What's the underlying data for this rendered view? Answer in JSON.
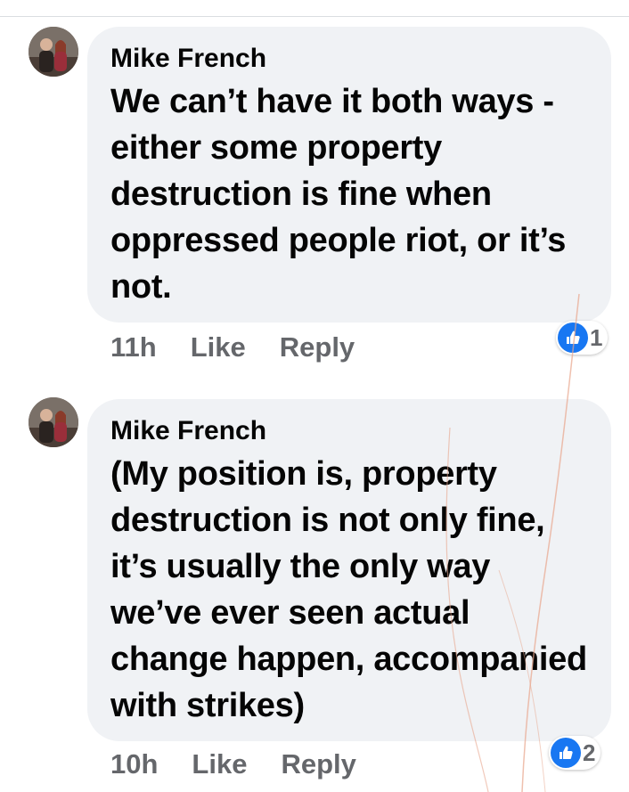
{
  "comments": [
    {
      "author": "Mike French",
      "text": "We can’t have it both ways - either some property destruction is fine when oppressed people riot, or it’s not.",
      "time": "11h",
      "like_label": "Like",
      "reply_label": "Reply",
      "reaction_icon": "thumbs-up-icon",
      "reaction_count": "1"
    },
    {
      "author": "Mike French",
      "text": "(My position is, property destruction is not only fine, it’s usually the only way we’ve ever seen actual change happen, accompanied with strikes)",
      "time": "10h",
      "like_label": "Like",
      "reply_label": "Reply",
      "reaction_icon": "thumbs-up-icon",
      "reaction_count": "2"
    }
  ],
  "colors": {
    "bubble_bg": "#f0f2f5",
    "meta_text": "#65676b",
    "like_blue": "#1877f2"
  }
}
